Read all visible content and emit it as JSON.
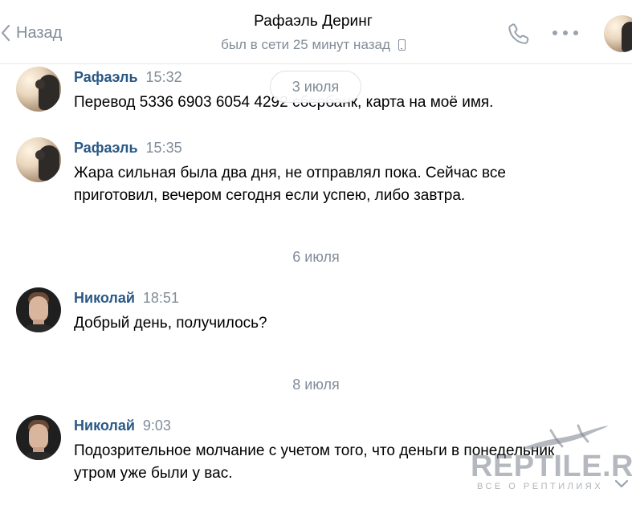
{
  "header": {
    "back_label": "Назад",
    "peer_name": "Рафаэль Деринг",
    "peer_status": "был в сети 25 минут назад"
  },
  "floating_date": "3 июля",
  "messages": [
    {
      "author": "Рафаэль",
      "time": "15:32",
      "text": "Перевод 5336 6903 6054 4292 сбербанк, карта на моё имя."
    },
    {
      "author": "Рафаэль",
      "time": "15:35",
      "text": "Жара сильная была два дня, не отправлял пока. Сейчас все приготовил, вечером сегодня если успею, либо завтра."
    },
    {
      "author": "Николай",
      "time": "18:51",
      "text": "Добрый день, получилось?"
    },
    {
      "author": "Николай",
      "time": "9:03",
      "text": "Подозрительное молчание с учетом того, что деньги в понедельник утром уже были у вас."
    }
  ],
  "date_separators": [
    "6 июля",
    "8 июля"
  ],
  "watermark": {
    "title": "REPTILE.RU",
    "subtitle": "ВСЕ О РЕПТИЛИЯХ"
  },
  "colors": {
    "link": "#2a5885",
    "secondary": "#818c99",
    "icon": "#99a2ad"
  },
  "icons": {
    "back": "chevron-left-icon",
    "call": "phone-icon",
    "more": "more-horizontal-icon",
    "device": "mobile-device-icon",
    "scroll": "chevron-down-icon"
  }
}
